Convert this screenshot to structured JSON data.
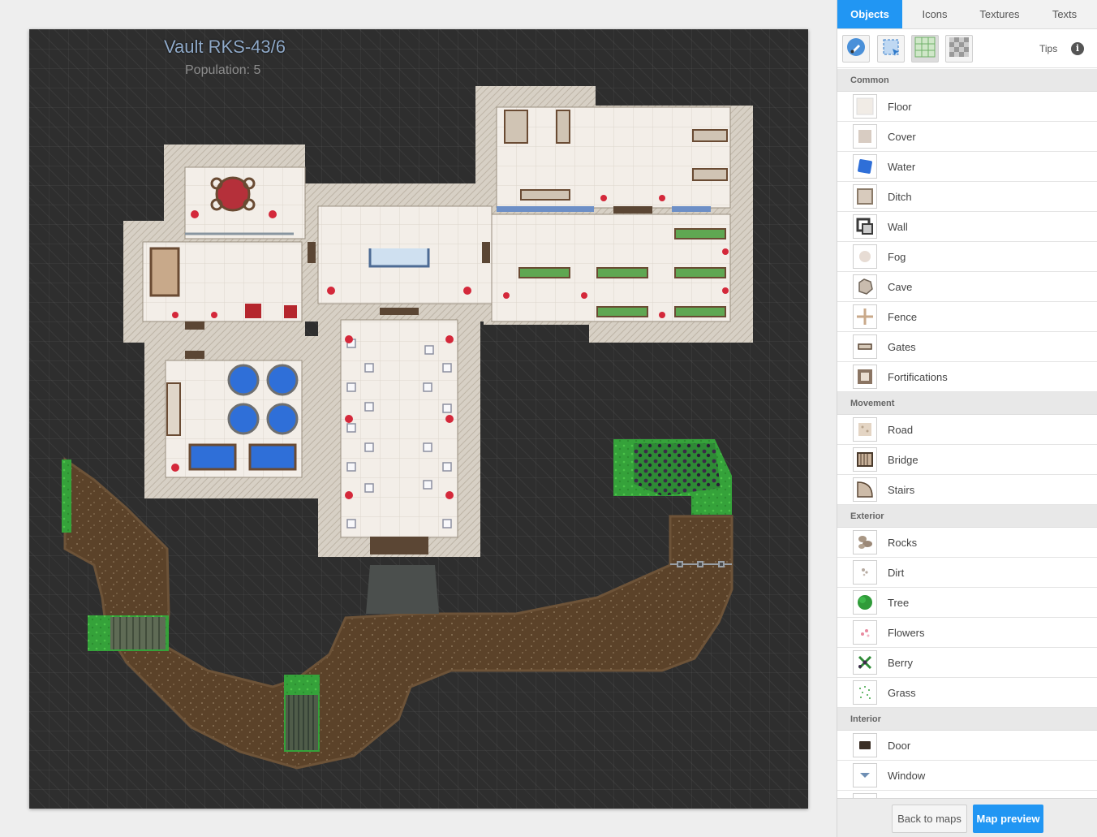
{
  "map": {
    "title": "Vault RKS-43/6",
    "subtitle": "Population: 5"
  },
  "sidebar": {
    "tabs": [
      {
        "label": "Objects",
        "active": true
      },
      {
        "label": "Icons",
        "active": false
      },
      {
        "label": "Textures",
        "active": false
      },
      {
        "label": "Texts",
        "active": false
      }
    ],
    "toolbar": {
      "tools": [
        "brush-icon",
        "select-icon",
        "grid-icon",
        "transparency-icon"
      ],
      "tips_label": "Tips",
      "info_glyph": "i"
    },
    "sections": [
      {
        "title": "Common",
        "items": [
          {
            "label": "Floor",
            "icon": "floor-icon"
          },
          {
            "label": "Cover",
            "icon": "cover-icon"
          },
          {
            "label": "Water",
            "icon": "water-icon"
          },
          {
            "label": "Ditch",
            "icon": "ditch-icon"
          },
          {
            "label": "Wall",
            "icon": "wall-icon"
          },
          {
            "label": "Fog",
            "icon": "fog-icon"
          },
          {
            "label": "Cave",
            "icon": "cave-icon"
          },
          {
            "label": "Fence",
            "icon": "fence-icon"
          },
          {
            "label": "Gates",
            "icon": "gates-icon"
          },
          {
            "label": "Fortifications",
            "icon": "fortifications-icon"
          }
        ]
      },
      {
        "title": "Movement",
        "items": [
          {
            "label": "Road",
            "icon": "road-icon"
          },
          {
            "label": "Bridge",
            "icon": "bridge-icon"
          },
          {
            "label": "Stairs",
            "icon": "stairs-icon"
          }
        ]
      },
      {
        "title": "Exterior",
        "items": [
          {
            "label": "Rocks",
            "icon": "rocks-icon"
          },
          {
            "label": "Dirt",
            "icon": "dirt-icon"
          },
          {
            "label": "Tree",
            "icon": "tree-icon"
          },
          {
            "label": "Flowers",
            "icon": "flowers-icon"
          },
          {
            "label": "Berry",
            "icon": "berry-icon"
          },
          {
            "label": "Grass",
            "icon": "grass-icon"
          }
        ]
      },
      {
        "title": "Interior",
        "items": [
          {
            "label": "Door",
            "icon": "door-icon"
          },
          {
            "label": "Window",
            "icon": "window-icon"
          }
        ]
      }
    ],
    "footer": {
      "back_label": "Back to maps",
      "preview_label": "Map preview"
    },
    "colors": {
      "accent": "#2196f3",
      "map_background": "#2e2e2e",
      "floor": "#f2ede6",
      "wall": "#cfc8bd",
      "dirt": "#5a4128",
      "grass": "#3da93a",
      "water": "#2f6fd8",
      "furniture_red": "#c8323c"
    }
  }
}
